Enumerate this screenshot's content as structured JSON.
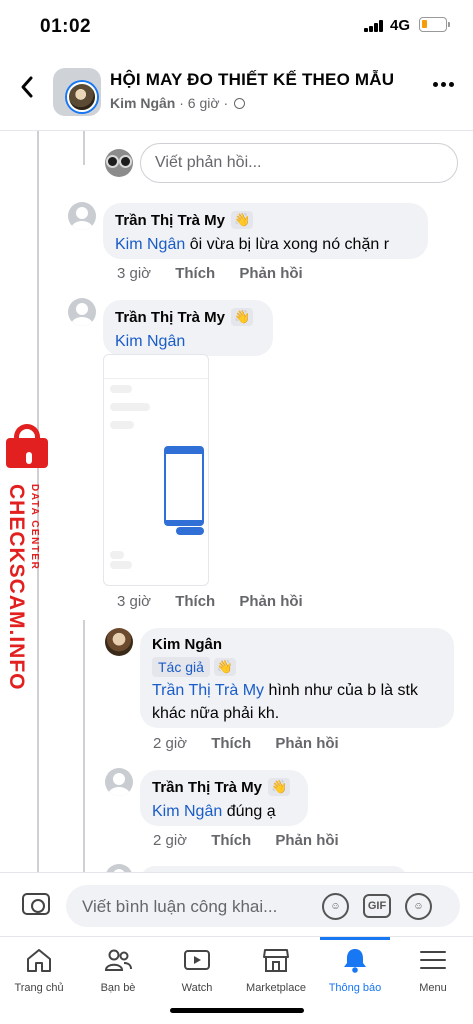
{
  "status": {
    "time": "01:02",
    "network": "4G"
  },
  "header": {
    "title": "HỘI MAY ĐO THIẾT KẾ THEO MẪU",
    "author": "Kim Ngân",
    "time": "6 giờ"
  },
  "reply_placeholder": "Viết phản hồi...",
  "comments": [
    {
      "name": "Trần Thị Trà My",
      "mention": "Kim Ngân",
      "text": "ôi vừa bị lừa xong nó chặn r",
      "time": "3 giờ",
      "like": "Thích",
      "reply": "Phản hồi"
    },
    {
      "name": "Trần Thị Trà My",
      "mention": "Kim Ngân",
      "text": "",
      "time": "3 giờ",
      "like": "Thích",
      "reply": "Phản hồi"
    },
    {
      "name": "Kim Ngân",
      "badge": "Tác giả",
      "mention": "Trần Thị Trà My",
      "text_1": "hình như của b là stk",
      "text_2": "khác nữa phải kh.",
      "time": "2 giờ",
      "like": "Thích",
      "reply": "Phản hồi"
    },
    {
      "name": "Trần Thị Trà My",
      "mention": "Kim Ngân",
      "text": "đúng ạ",
      "time": "2 giờ",
      "like": "Thích",
      "reply": "Phản hồi"
    }
  ],
  "watermark": {
    "brand": "CHECKSCAM.INFO",
    "sub": "DATA CENTER"
  },
  "comment_bar": {
    "placeholder": "Viết bình luận công khai...",
    "gif": "GIF"
  },
  "tabs": [
    {
      "label": "Trang chủ",
      "icon": "home-icon"
    },
    {
      "label": "Bạn bè",
      "icon": "friends-icon"
    },
    {
      "label": "Watch",
      "icon": "watch-icon"
    },
    {
      "label": "Marketplace",
      "icon": "marketplace-icon"
    },
    {
      "label": "Thông báo",
      "icon": "bell-icon",
      "active": true
    },
    {
      "label": "Menu",
      "icon": "menu-icon"
    }
  ],
  "colors": {
    "link": "#1a5cc8",
    "accent": "#1877f2",
    "bubble": "#f0f2f5",
    "watermark": "#e22020"
  }
}
